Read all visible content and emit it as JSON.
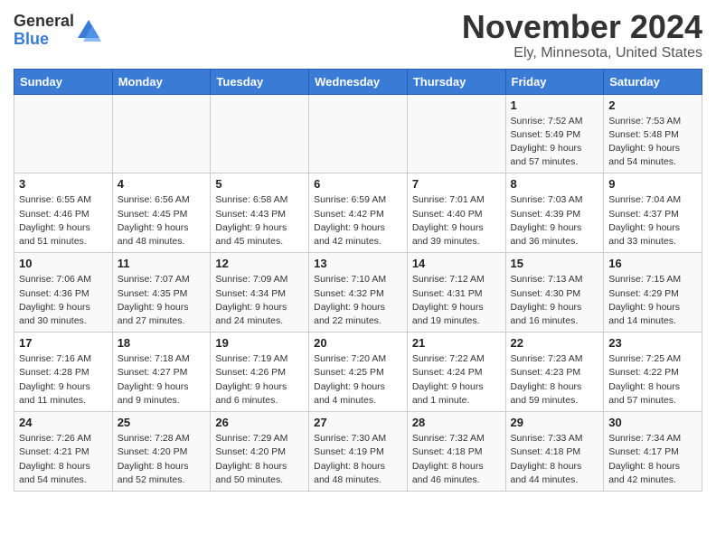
{
  "logo": {
    "general": "General",
    "blue": "Blue"
  },
  "title": "November 2024",
  "location": "Ely, Minnesota, United States",
  "days_of_week": [
    "Sunday",
    "Monday",
    "Tuesday",
    "Wednesday",
    "Thursday",
    "Friday",
    "Saturday"
  ],
  "weeks": [
    [
      {
        "day": "",
        "info": ""
      },
      {
        "day": "",
        "info": ""
      },
      {
        "day": "",
        "info": ""
      },
      {
        "day": "",
        "info": ""
      },
      {
        "day": "",
        "info": ""
      },
      {
        "day": "1",
        "info": "Sunrise: 7:52 AM\nSunset: 5:49 PM\nDaylight: 9 hours and 57 minutes."
      },
      {
        "day": "2",
        "info": "Sunrise: 7:53 AM\nSunset: 5:48 PM\nDaylight: 9 hours and 54 minutes."
      }
    ],
    [
      {
        "day": "3",
        "info": "Sunrise: 6:55 AM\nSunset: 4:46 PM\nDaylight: 9 hours and 51 minutes."
      },
      {
        "day": "4",
        "info": "Sunrise: 6:56 AM\nSunset: 4:45 PM\nDaylight: 9 hours and 48 minutes."
      },
      {
        "day": "5",
        "info": "Sunrise: 6:58 AM\nSunset: 4:43 PM\nDaylight: 9 hours and 45 minutes."
      },
      {
        "day": "6",
        "info": "Sunrise: 6:59 AM\nSunset: 4:42 PM\nDaylight: 9 hours and 42 minutes."
      },
      {
        "day": "7",
        "info": "Sunrise: 7:01 AM\nSunset: 4:40 PM\nDaylight: 9 hours and 39 minutes."
      },
      {
        "day": "8",
        "info": "Sunrise: 7:03 AM\nSunset: 4:39 PM\nDaylight: 9 hours and 36 minutes."
      },
      {
        "day": "9",
        "info": "Sunrise: 7:04 AM\nSunset: 4:37 PM\nDaylight: 9 hours and 33 minutes."
      }
    ],
    [
      {
        "day": "10",
        "info": "Sunrise: 7:06 AM\nSunset: 4:36 PM\nDaylight: 9 hours and 30 minutes."
      },
      {
        "day": "11",
        "info": "Sunrise: 7:07 AM\nSunset: 4:35 PM\nDaylight: 9 hours and 27 minutes."
      },
      {
        "day": "12",
        "info": "Sunrise: 7:09 AM\nSunset: 4:34 PM\nDaylight: 9 hours and 24 minutes."
      },
      {
        "day": "13",
        "info": "Sunrise: 7:10 AM\nSunset: 4:32 PM\nDaylight: 9 hours and 22 minutes."
      },
      {
        "day": "14",
        "info": "Sunrise: 7:12 AM\nSunset: 4:31 PM\nDaylight: 9 hours and 19 minutes."
      },
      {
        "day": "15",
        "info": "Sunrise: 7:13 AM\nSunset: 4:30 PM\nDaylight: 9 hours and 16 minutes."
      },
      {
        "day": "16",
        "info": "Sunrise: 7:15 AM\nSunset: 4:29 PM\nDaylight: 9 hours and 14 minutes."
      }
    ],
    [
      {
        "day": "17",
        "info": "Sunrise: 7:16 AM\nSunset: 4:28 PM\nDaylight: 9 hours and 11 minutes."
      },
      {
        "day": "18",
        "info": "Sunrise: 7:18 AM\nSunset: 4:27 PM\nDaylight: 9 hours and 9 minutes."
      },
      {
        "day": "19",
        "info": "Sunrise: 7:19 AM\nSunset: 4:26 PM\nDaylight: 9 hours and 6 minutes."
      },
      {
        "day": "20",
        "info": "Sunrise: 7:20 AM\nSunset: 4:25 PM\nDaylight: 9 hours and 4 minutes."
      },
      {
        "day": "21",
        "info": "Sunrise: 7:22 AM\nSunset: 4:24 PM\nDaylight: 9 hours and 1 minute."
      },
      {
        "day": "22",
        "info": "Sunrise: 7:23 AM\nSunset: 4:23 PM\nDaylight: 8 hours and 59 minutes."
      },
      {
        "day": "23",
        "info": "Sunrise: 7:25 AM\nSunset: 4:22 PM\nDaylight: 8 hours and 57 minutes."
      }
    ],
    [
      {
        "day": "24",
        "info": "Sunrise: 7:26 AM\nSunset: 4:21 PM\nDaylight: 8 hours and 54 minutes."
      },
      {
        "day": "25",
        "info": "Sunrise: 7:28 AM\nSunset: 4:20 PM\nDaylight: 8 hours and 52 minutes."
      },
      {
        "day": "26",
        "info": "Sunrise: 7:29 AM\nSunset: 4:20 PM\nDaylight: 8 hours and 50 minutes."
      },
      {
        "day": "27",
        "info": "Sunrise: 7:30 AM\nSunset: 4:19 PM\nDaylight: 8 hours and 48 minutes."
      },
      {
        "day": "28",
        "info": "Sunrise: 7:32 AM\nSunset: 4:18 PM\nDaylight: 8 hours and 46 minutes."
      },
      {
        "day": "29",
        "info": "Sunrise: 7:33 AM\nSunset: 4:18 PM\nDaylight: 8 hours and 44 minutes."
      },
      {
        "day": "30",
        "info": "Sunrise: 7:34 AM\nSunset: 4:17 PM\nDaylight: 8 hours and 42 minutes."
      }
    ]
  ]
}
